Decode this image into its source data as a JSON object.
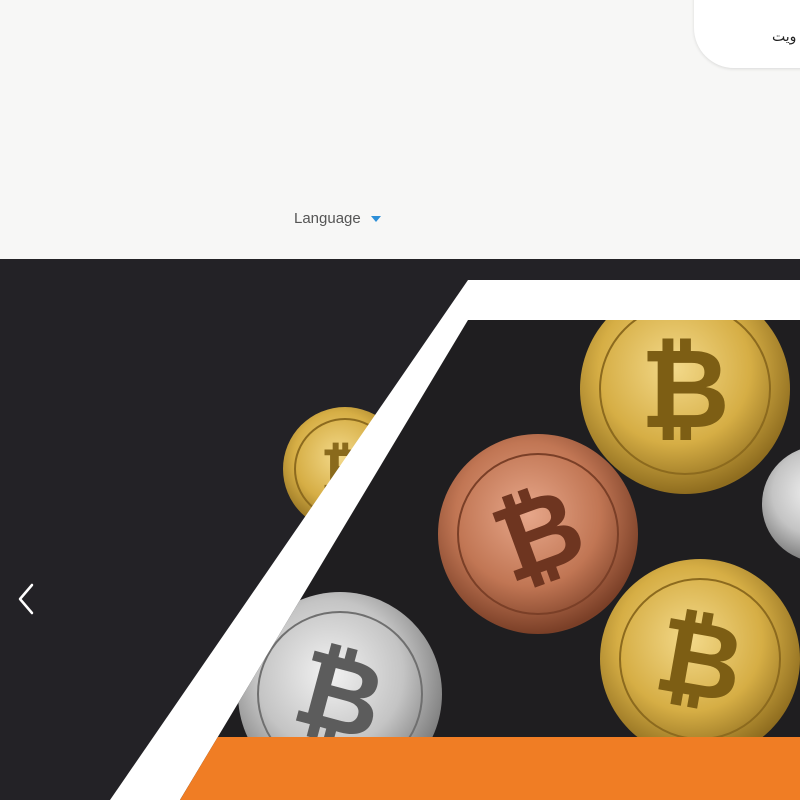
{
  "header": {
    "top_card_label": "ويت",
    "language_label": "Language",
    "language_icon": "caret-down-icon"
  },
  "hero": {
    "prev_icon": "chevron-left-icon",
    "image_subject": "bitcoin coins",
    "colors": {
      "background": "#232226",
      "frame": "#ffffff",
      "accent_band": "#f07d24",
      "gold": "#d9b64a",
      "copper": "#c17654",
      "silver": "#c8c8c8"
    }
  }
}
